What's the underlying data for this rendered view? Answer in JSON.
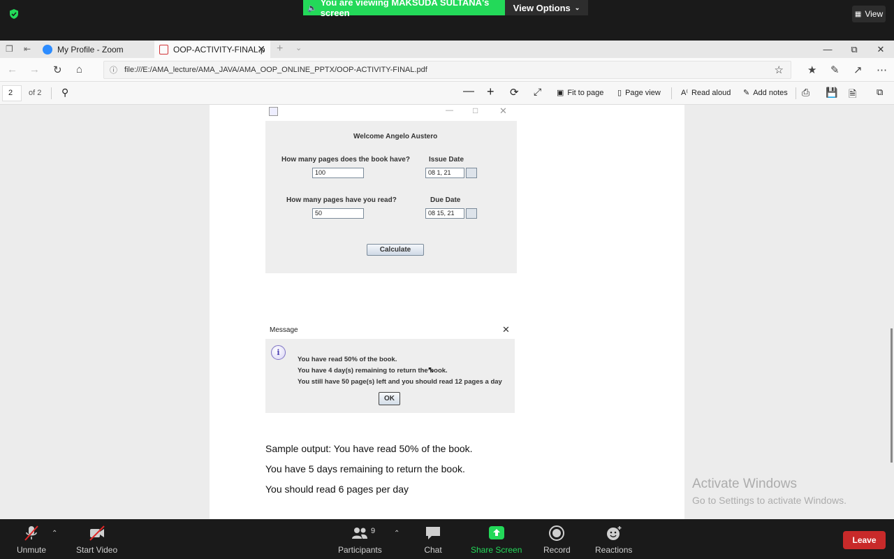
{
  "zoom_top": {
    "banner": "You are viewing MAKSUDA SULTANA's screen",
    "view_options": "View Options",
    "view": "View"
  },
  "browser": {
    "tabs": [
      {
        "label": "My Profile - Zoom"
      },
      {
        "label": "OOP-ACTIVITY-FINAL.p"
      }
    ],
    "url": "file:///E:/AMA_lecture/AMA_JAVA/AMA_OOP_ONLINE_PPTX/OOP-ACTIVITY-FINAL.pdf"
  },
  "pdf_toolbar": {
    "page": "2",
    "page_of": "of 2",
    "fit_to_page": "Fit to page",
    "page_view": "Page view",
    "read_aloud": "Read aloud",
    "add_notes": "Add notes"
  },
  "java_form": {
    "welcome": "Welcome Angelo Austero",
    "q_pages_book": "How many pages does the book have?",
    "pages_book_value": "100",
    "issue_date_label": "Issue Date",
    "issue_date_value": "08 1, 21",
    "q_pages_read": "How many pages have you read?",
    "pages_read_value": "50",
    "due_date_label": "Due Date",
    "due_date_value": "08 15, 21",
    "calculate": "Calculate"
  },
  "message_dialog": {
    "title": "Message",
    "line1": "You have read 50% of the book.",
    "line2": "You have 4 day(s) remaining to return the book.",
    "line3": "You still have 50 page(s) left and you should read 12 pages a day",
    "ok": "OK"
  },
  "sample_output": {
    "line1": "Sample output: You have read 50% of the book.",
    "line2": "You have 5 days remaining to return the book.",
    "line3": "You should read 6 pages per day"
  },
  "activate_windows": {
    "title": "Activate Windows",
    "subtitle": "Go to Settings to activate Windows."
  },
  "zoom_bottom": {
    "unmute": "Unmute",
    "start_video": "Start Video",
    "participants": "Participants",
    "participants_count": "9",
    "chat": "Chat",
    "share_screen": "Share Screen",
    "record": "Record",
    "reactions": "Reactions",
    "leave": "Leave"
  },
  "colors": {
    "zoom_green": "#23d959",
    "leave_red": "#c82a2a",
    "zoom_dark": "#1a1a1a"
  }
}
